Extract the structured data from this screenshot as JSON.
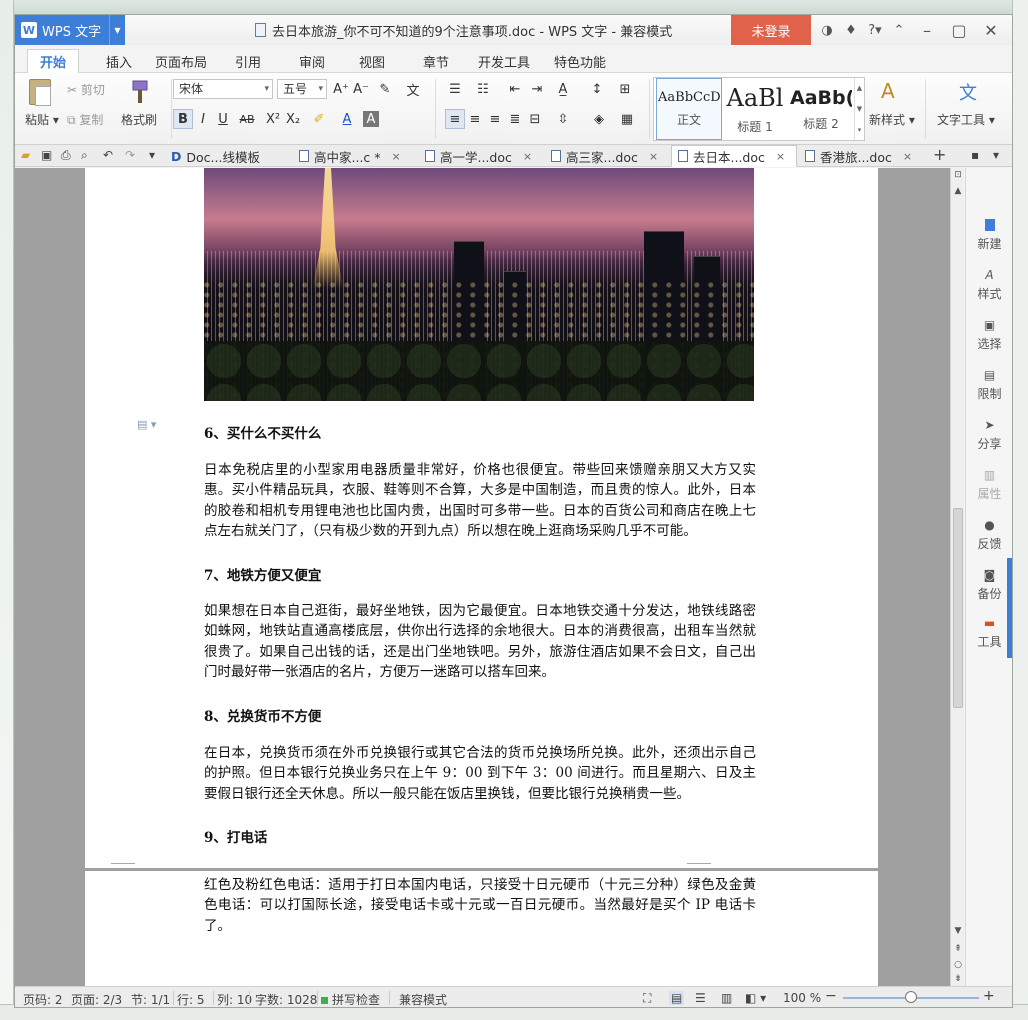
{
  "app": {
    "name": "WPS 文字",
    "logo": "W"
  },
  "window": {
    "title": "去日本旅游_你不可不知道的9个注意事项.doc - WPS 文字 - 兼容模式",
    "login": "未登录"
  },
  "menu_tabs": [
    "开始",
    "插入",
    "页面布局",
    "引用",
    "审阅",
    "视图",
    "章节",
    "开发工具",
    "特色功能"
  ],
  "ribbon": {
    "paste": "粘贴",
    "cut": "剪切",
    "copy": "复制",
    "format_painter": "格式刷",
    "font_name": "宋体",
    "font_size": "五号",
    "styles": [
      {
        "preview": "AaBbCcD",
        "name": "正文"
      },
      {
        "preview": "AaBl",
        "name": "标题 1"
      },
      {
        "preview": "AaBb(",
        "name": "标题 2"
      }
    ],
    "new_style": "新样式",
    "text_tools": "文字工具"
  },
  "doc_tabs": [
    {
      "label": "Doc...线模板",
      "close": ""
    },
    {
      "label": "高中家...c *",
      "close": "×"
    },
    {
      "label": "高一学...doc",
      "close": "×"
    },
    {
      "label": "高三家...doc",
      "close": "×"
    },
    {
      "label": "去日本...doc",
      "close": "×"
    },
    {
      "label": "香港旅...doc",
      "close": "×"
    }
  ],
  "document": {
    "sections": [
      {
        "heading": "6、买什么不买什么",
        "body": "日本免税店里的小型家用电器质量非常好，价格也很便宜。带些回来馈赠亲朋又大方又实惠。买小件精品玩具，衣服、鞋等则不合算，大多是中国制造，而且贵的惊人。此外，日本的胶卷和相机专用锂电池也比国内贵，出国时可多带一些。日本的百货公司和商店在晚上七点左右就关门了，（只有极少数的开到九点）所以想在晚上逛商场采购几乎不可能。"
      },
      {
        "heading": "7、地铁方便又便宜",
        "body": "如果想在日本自己逛街，最好坐地铁，因为它最便宜。日本地铁交通十分发达，地铁线路密如蛛网，地铁站直通高楼底层，供你出行选择的余地很大。日本的消费很高，出租车当然就很贵了。如果自己出钱的话，还是出门坐地铁吧。另外，旅游住酒店如果不会日文，自己出门时最好带一张酒店的名片，方便万一迷路可以搭车回来。"
      },
      {
        "heading": "8、兑换货币不方便",
        "body": "在日本，兑换货币须在外币兑换银行或其它合法的货币兑换场所兑换。此外，还须出示自己的护照。但日本银行兑换业务只在上午 9：00 到下午 3：00 间进行。而且星期六、日及主要假日银行还全天休息。所以一般只能在饭店里换钱，但要比银行兑换稍贵一些。"
      },
      {
        "heading": "9、打电话",
        "body": ""
      }
    ],
    "page2_body": "红色及粉红色电话：适用于打日本国内电话，只接受十日元硬币（十元三分种）绿色及金黄色电话：可以打国际长途，接受电话卡或十元或一百日元硬币。当然最好是买个 IP 电话卡了。"
  },
  "right_panel": [
    "新建",
    "样式",
    "选择",
    "限制",
    "分享",
    "属性",
    "反馈",
    "备份",
    "工具"
  ],
  "status": {
    "page": "页码: 2",
    "pages": "页面: 2/3",
    "section": "节: 1/1",
    "line": "行: 5",
    "col": "列: 10",
    "words": "字数: 1028",
    "spell": "拼写检查",
    "mode": "兼容模式",
    "zoom": "100 %"
  },
  "colors": {
    "accent": "#3c7ed8",
    "login": "#e0624b"
  }
}
